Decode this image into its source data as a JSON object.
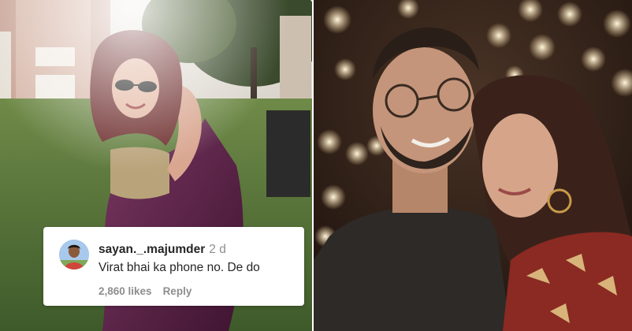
{
  "comment": {
    "username": "sayan._.majumder",
    "timestamp": "2 d",
    "text": "Virat bhai ka phone no. De do",
    "likes": "2,860 likes",
    "reply_label": "Reply"
  },
  "colors": {
    "saree": "#5a2148",
    "lawn": "#4d6b35",
    "bokeh_background": "#2a1a14"
  }
}
